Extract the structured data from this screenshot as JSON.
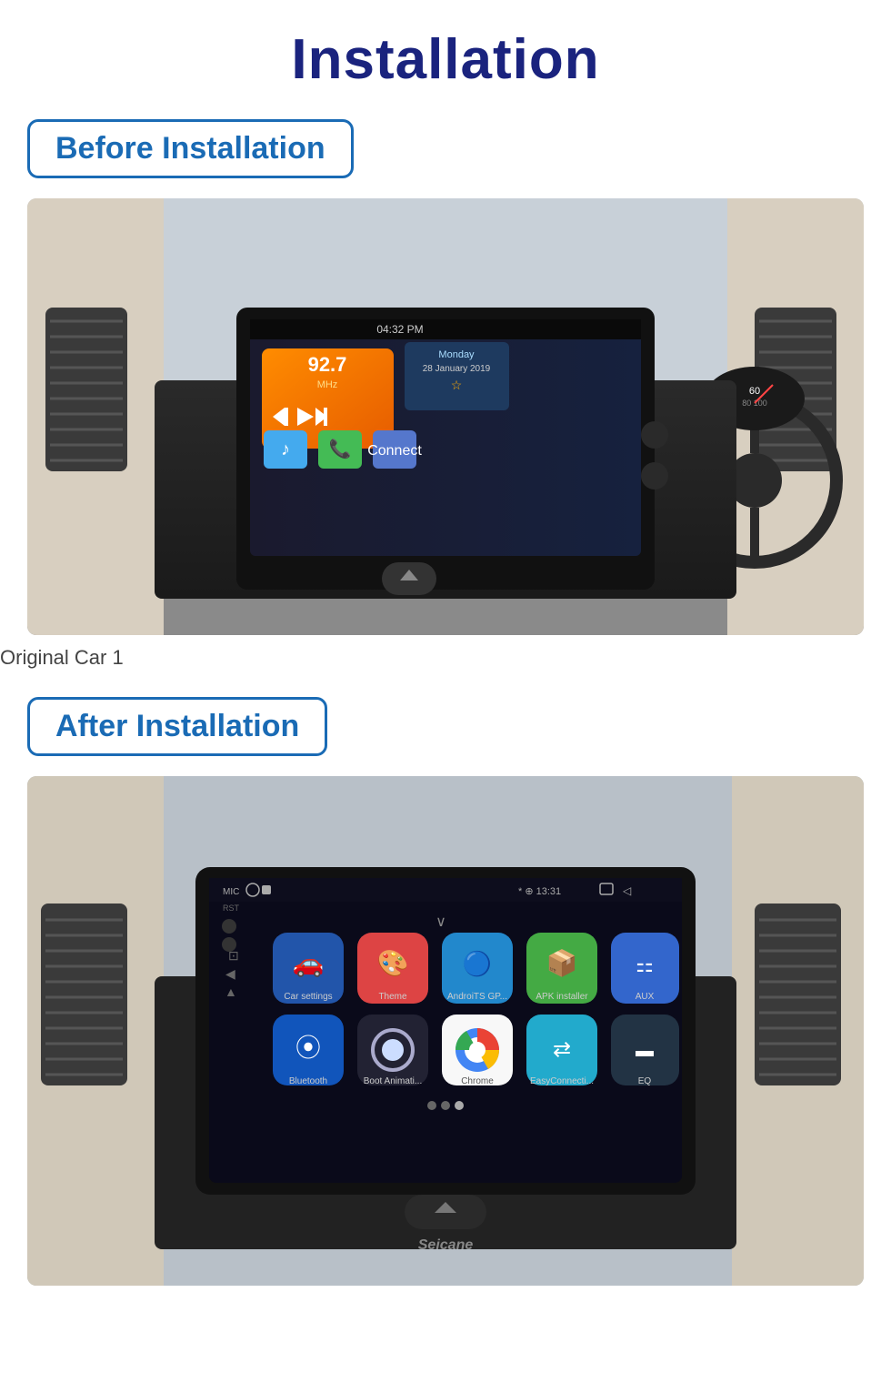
{
  "page": {
    "title": "Installation",
    "before_label": "Before Installation",
    "after_label": "After Installation",
    "caption": "Original Car  1",
    "brand": "Seicane"
  }
}
